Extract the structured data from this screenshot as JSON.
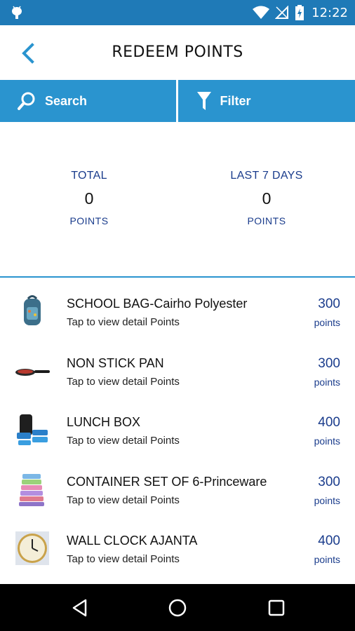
{
  "status_bar": {
    "time": "12:22",
    "icons": [
      "android-debug-icon",
      "wifi-icon",
      "no-sim-icon",
      "battery-charging-icon"
    ]
  },
  "header": {
    "title": "REDEEM POINTS",
    "back_icon": "back-arrow-icon"
  },
  "toolbar": {
    "search_label": "Search",
    "filter_label": "Filter",
    "background_color": "#2a94cf"
  },
  "stats": {
    "total": {
      "label": "TOTAL",
      "value": "0",
      "unit": "POINTS"
    },
    "last_7_days": {
      "label": "LAST 7 DAYS",
      "value": "0",
      "unit": "POINTS"
    }
  },
  "items": [
    {
      "name": "SCHOOL BAG-Cairho Polyester",
      "subtitle": "Tap to view detail Points",
      "points": "300",
      "points_unit": "points",
      "thumb": "school-bag"
    },
    {
      "name": "NON STICK PAN",
      "subtitle": "Tap to view detail Points",
      "points": "300",
      "points_unit": "points",
      "thumb": "pan"
    },
    {
      "name": "LUNCH BOX",
      "subtitle": "Tap to view detail Points",
      "points": "400",
      "points_unit": "points",
      "thumb": "lunch-box"
    },
    {
      "name": "CONTAINER SET OF 6-Princeware",
      "subtitle": "Tap to view detail Points",
      "points": "300",
      "points_unit": "points",
      "thumb": "container-set"
    },
    {
      "name": "WALL CLOCK AJANTA",
      "subtitle": "Tap to view detail Points",
      "points": "400",
      "points_unit": "points",
      "thumb": "wall-clock"
    }
  ],
  "nav_bar": {
    "buttons": [
      "back-triangle-icon",
      "home-circle-icon",
      "recents-square-icon"
    ]
  },
  "colors": {
    "status_bar": "#1f7ab7",
    "accent": "#2a94cf",
    "points_text": "#1a3c8c"
  }
}
